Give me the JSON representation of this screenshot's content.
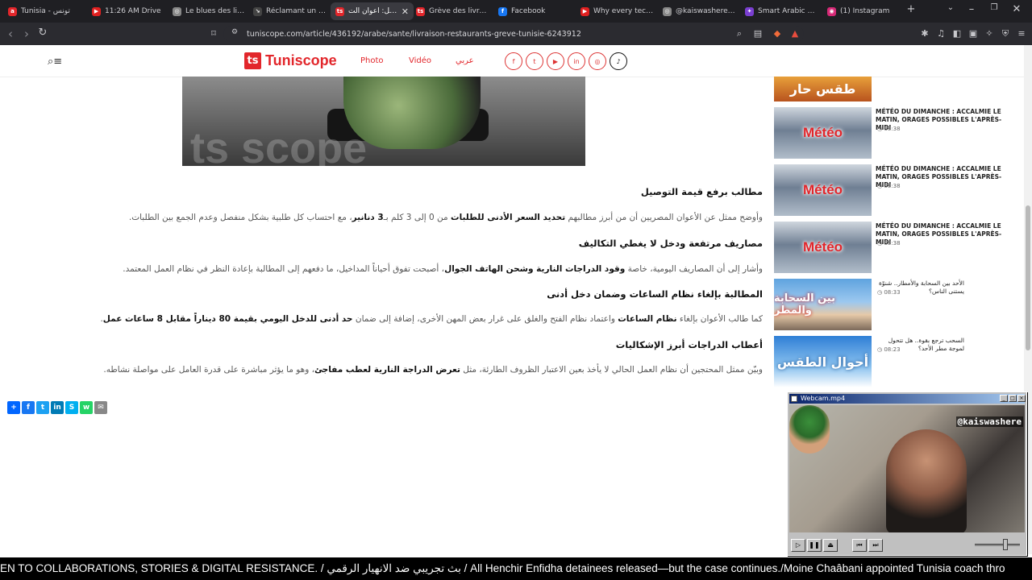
{
  "browser": {
    "tabs": [
      {
        "title": "Tunisia - تونس",
        "fav_color": "#e2262b",
        "fav": "a"
      },
      {
        "title": "11:26 AM Drive",
        "fav_color": "#e02020",
        "fav": "▶"
      },
      {
        "title": "Le blues des livreurs",
        "fav_color": "#888888",
        "fav": "◎"
      },
      {
        "title": "Réclamant un rever",
        "fav_color": "#444444",
        "fav": "↘"
      },
      {
        "title": "عاجل: أعوان الت",
        "fav_color": "#e2262b",
        "fav": "ts"
      },
      {
        "title": "Grève des livreurs d",
        "fav_color": "#e2262b",
        "fav": "ts"
      },
      {
        "title": "Facebook",
        "fav_color": "#1877f2",
        "fav": "f"
      },
      {
        "title": "Why every tech com",
        "fav_color": "#e02020",
        "fav": "▶"
      },
      {
        "title": "@kaiswashere - me",
        "fav_color": "#888888",
        "fav": "◎"
      },
      {
        "title": "Smart Arabic Keyb",
        "fav_color": "#7a3fd1",
        "fav": "✦"
      },
      {
        "title": "(1) Instagram",
        "fav_color": "#d62976",
        "fav": "◉"
      }
    ],
    "url": "tuniscope.com/article/436192/arabe/sante/livraison-restaurants-greve-tunisie-6243912"
  },
  "site": {
    "logo_text": "Tuniscope",
    "logo_mark": "ts",
    "nav": {
      "photo": "Photo",
      "video": "Vidéo",
      "arabic": "عربي"
    },
    "socials": [
      "f",
      "t",
      "▶",
      "in",
      "◎",
      "♪"
    ],
    "hero_watermark": "ts   scope"
  },
  "article": {
    "h1": "مطالب برفع قيمة التوصيل",
    "p1_pre": "وأوضح ممثل عن الأعوان المصريين أن من أبرز مطالبهم ",
    "p1_b1": "تحديد السعر الأدنى للطلبات",
    "p1_mid": " من 0 إلى 3 كلم بـ",
    "p1_b2": "3 دنانير",
    "p1_post": "، مع احتساب كل طلبية بشكل منفصل وعدم الجمع بين الطلبات.",
    "h2": "مصاريف مرتفعة ودخل لا يغطي التكاليف",
    "p2_pre": "وأشار إلى أن المصاريف اليومية، خاصة ",
    "p2_b1": "وقود الدراجات النارية وشحن الهاتف الجوال",
    "p2_post": "، أصبحت تفوق أحياناً المداخيل، ما دفعهم إلى المطالبة بإعادة النظر في نظام العمل المعتمد.",
    "h3": "المطالبة بإلغاء نظام الساعات وضمان دخل أدنى",
    "p3_pre": "كما طالب الأعوان بإلغاء ",
    "p3_b1": "نظام الساعات",
    "p3_mid": " واعتماد نظام الفتح والغلق على غرار بعض المهن الأخرى، إضافة إلى ضمان ",
    "p3_b2": "حد أدنى للدخل اليومي بقيمة 80 ديناراً مقابل 8 ساعات عمل",
    "p3_post": ".",
    "h4": "أعطاب الدراجات أبرز الإشكاليات",
    "p4_pre": "وبيّن ممثل المحتجين أن نظام العمل الحالي لا يأخذ بعين الاعتبار الظروف الطارئة، مثل ",
    "p4_b1": "تعرض الدراجة النارية لعطب مفاجئ",
    "p4_post": "، وهو ما يؤثر مباشرة على قدرة العامل على مواصلة نشاطه."
  },
  "share_colors": [
    "#0166ff",
    "#1877f2",
    "#1da1f2",
    "#007bb5",
    "#00aff0",
    "#25d366",
    "#888888"
  ],
  "share_glyphs": [
    "+",
    "f",
    "t",
    "in",
    "S",
    "w",
    "✉"
  ],
  "sidebar": [
    {
      "kind": "orange",
      "thumb_text": "طقس حار",
      "title": "",
      "time": ""
    },
    {
      "kind": "meteo",
      "thumb_text": "Météo",
      "title": "MÉTÉO DU DIMANCHE : ACCALMIE LE MATIN, ORAGES POSSIBLES L'APRÈS-MIDI",
      "time": "08:38"
    },
    {
      "kind": "meteo",
      "thumb_text": "Météo",
      "title": "MÉTÉO DU DIMANCHE : ACCALMIE LE MATIN, ORAGES POSSIBLES L'APRÈS-MIDI",
      "time": "08:38"
    },
    {
      "kind": "meteo",
      "thumb_text": "Météo",
      "title": "MÉTÉO DU DIMANCHE : ACCALMIE LE MATIN, ORAGES POSSIBLES L'APRÈS-MIDI",
      "time": "08:38"
    },
    {
      "kind": "crowd",
      "thumb_text": "بين السحابة والمطر",
      "title": "الأحد بين السحابة والأمطار.. شنوّة يستنى الناس؟",
      "time": "08:33"
    },
    {
      "kind": "sky",
      "thumb_text": "أحوال الطقس",
      "title": "السحب ترجع بقوة.. هل تتحول لموجة مطر الأحد؟",
      "time": "08:23"
    }
  ],
  "webcam": {
    "title": "Webcam.mp4",
    "handle": "@kaiswashere",
    "buttons": [
      "▷",
      "❚❚",
      "⏏",
      "⏮",
      "⏭"
    ]
  },
  "ticker": "EN TO COLLABORATIONS, STORIES & DIGITAL RESISTANCE. / بث تجريبي ضد الانهيار الرقمي / All Henchir Enfidha detainees released—but the case continues./Moine Chaâbani appointed Tunisia coach thro"
}
